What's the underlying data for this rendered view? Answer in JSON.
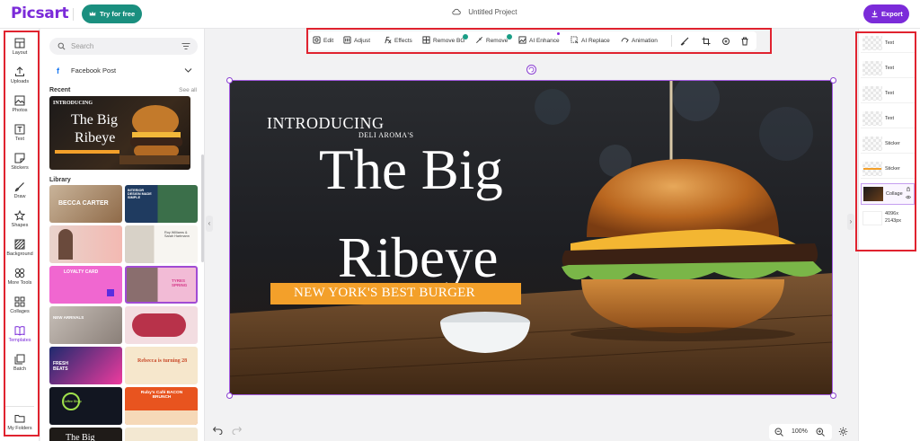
{
  "header": {
    "logo": "Picsart",
    "try_label": "Try for free",
    "project_title": "Untitled Project",
    "export_label": "Export"
  },
  "rail": {
    "items": [
      {
        "label": "Layout",
        "icon": "layout-icon"
      },
      {
        "label": "Uploads",
        "icon": "upload-icon"
      },
      {
        "label": "Photos",
        "icon": "photo-icon"
      },
      {
        "label": "Text",
        "icon": "text-icon"
      },
      {
        "label": "Stickers",
        "icon": "sticker-icon"
      },
      {
        "label": "Draw",
        "icon": "brush-icon"
      },
      {
        "label": "Shapes",
        "icon": "star-icon"
      },
      {
        "label": "Background",
        "icon": "background-icon"
      },
      {
        "label": "More Tools",
        "icon": "tools-icon"
      },
      {
        "label": "Collages",
        "icon": "collage-icon"
      },
      {
        "label": "Templates",
        "icon": "book-icon"
      },
      {
        "label": "Batch",
        "icon": "batch-icon"
      },
      {
        "label": "My Folders",
        "icon": "folder-icon"
      }
    ]
  },
  "panel": {
    "search_placeholder": "Search",
    "format": "Facebook Post",
    "recent_label": "Recent",
    "see_all": "See all",
    "library_label": "Library",
    "recent_thumb": {
      "intro": "INTRODUCING",
      "title1": "The Big",
      "title2": "Ribeye"
    },
    "templates": [
      {
        "text": "BECCA CARTER"
      },
      {
        "text": "INTERIOR DESIGN MADE SIMPLE"
      },
      {
        "text": ""
      },
      {
        "text": "Roy Williams & Sarah Hartmann"
      },
      {
        "text": "LOYALTY CARD"
      },
      {
        "text": "TYRES SPRING"
      },
      {
        "text": "NEW ARRIVALS"
      },
      {
        "text": ""
      },
      {
        "text": "FRESH BEATS"
      },
      {
        "text": "Rebecca is turning 28"
      },
      {
        "text": "Coffee Shop"
      },
      {
        "text": "Ruby's Café BACON BRUNCH"
      },
      {
        "text": "The Big"
      },
      {
        "text": ""
      }
    ]
  },
  "toolbar": {
    "items": [
      {
        "label": "Edit",
        "icon": "edit-icon"
      },
      {
        "label": "Adjust",
        "icon": "adjust-icon"
      },
      {
        "label": "Effects",
        "icon": "effects-icon"
      },
      {
        "label": "Remove BG",
        "icon": "remove-bg-icon"
      },
      {
        "label": "Remove",
        "icon": "eraser-icon"
      },
      {
        "label": "AI Enhance",
        "icon": "enhance-icon"
      },
      {
        "label": "AI Replace",
        "icon": "replace-icon"
      },
      {
        "label": "Animation",
        "icon": "animation-icon"
      }
    ],
    "actions": [
      "brush-icon",
      "crop-icon",
      "replace-image-icon",
      "trash-icon"
    ]
  },
  "canvas": {
    "intro": "INTRODUCING",
    "brand": "DELI AROMA'S",
    "title_line1": "The Big",
    "title_line2": "Ribeye",
    "tagline": "NEW YORK'S BEST BURGER",
    "band_color": "#f3a02a"
  },
  "zoom": {
    "value": "100%"
  },
  "layers": {
    "items": [
      {
        "label": "Text"
      },
      {
        "label": "Text"
      },
      {
        "label": "Text"
      },
      {
        "label": "Text"
      },
      {
        "label": "Sticker"
      },
      {
        "label": "Sticker"
      },
      {
        "label": "Collage"
      },
      {
        "label": "4096x 2143px"
      }
    ]
  },
  "colors": {
    "accent": "#7b2bd9",
    "highlight": "#e0232f",
    "try_button": "#1a8f7f"
  }
}
